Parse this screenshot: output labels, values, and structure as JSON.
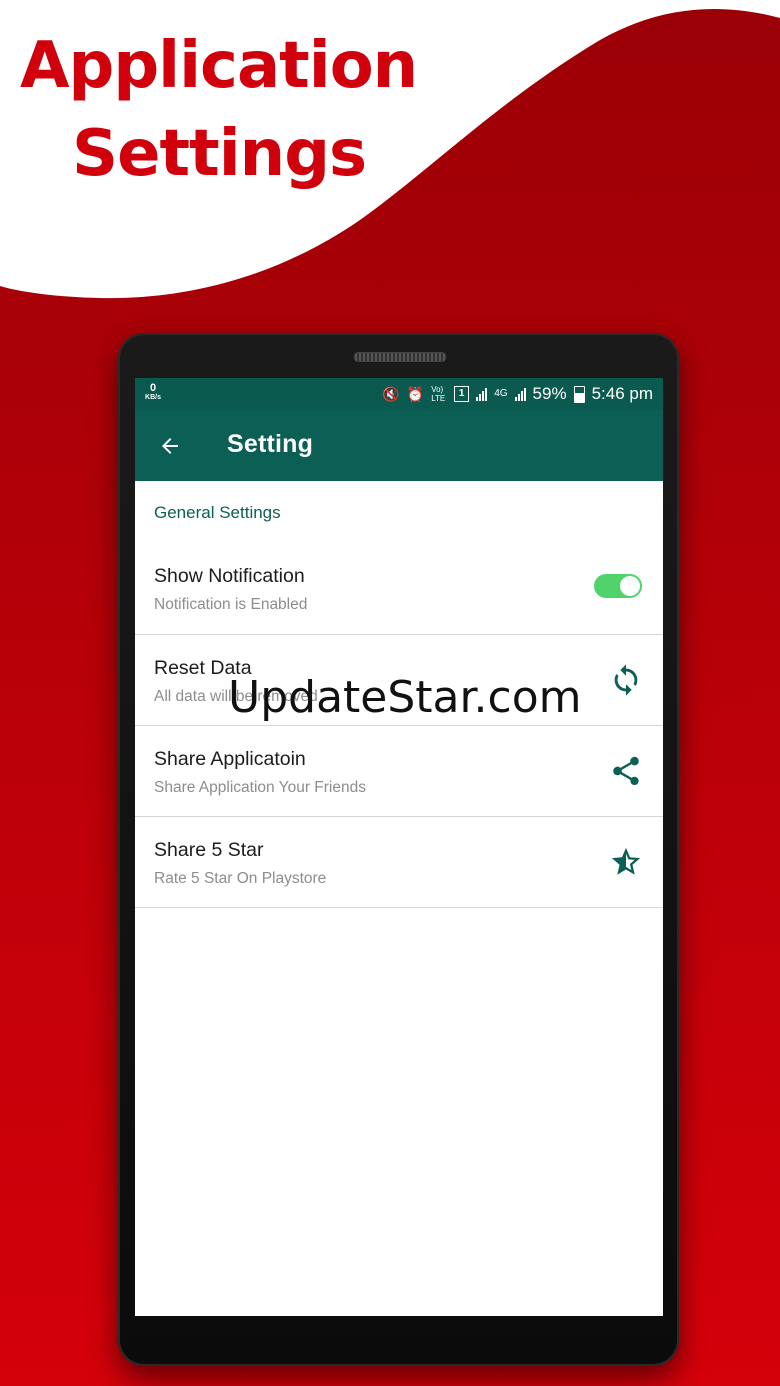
{
  "promo": {
    "title_line1": "Application",
    "title_line2": "Settings"
  },
  "status_bar": {
    "speed_value": "0",
    "speed_unit": "KB/s",
    "volte": "Vo) LTE",
    "sim": "1",
    "network": "4G",
    "battery": "59%",
    "time": "5:46 pm"
  },
  "toolbar": {
    "title": "Setting",
    "back_icon": "arrow-left-icon"
  },
  "settings": {
    "section_header": "General Settings",
    "items": [
      {
        "title": "Show Notification",
        "subtitle": "Notification is Enabled",
        "control": "toggle",
        "toggle_on": true
      },
      {
        "title": "Reset Data",
        "subtitle": "All data will be removed",
        "icon": "refresh-icon"
      },
      {
        "title": "Share Applicatoin",
        "subtitle": "Share Application Your Friends",
        "icon": "share-icon"
      },
      {
        "title": "Share 5 Star",
        "subtitle": "Rate 5 Star On Playstore",
        "icon": "star-half-icon"
      }
    ]
  },
  "watermark": "UpdateStar.com",
  "colors": {
    "accent_red": "#d0010c",
    "toolbar_teal": "#0b5f55",
    "toggle_green": "#4fd36a"
  }
}
